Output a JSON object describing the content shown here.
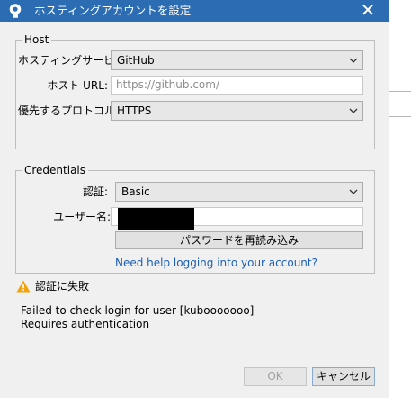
{
  "window": {
    "title": "ホスティングアカウントを設定",
    "close_glyph": "✕"
  },
  "host": {
    "legend": "Host",
    "service_label": "ホスティングサービス:",
    "service_value": "GitHub",
    "url_label": "ホスト URL:",
    "url_placeholder": "https://github.com/",
    "protocol_label": "優先するプロトコル:",
    "protocol_value": "HTTPS"
  },
  "credentials": {
    "legend": "Credentials",
    "auth_label": "認証:",
    "auth_value": "Basic",
    "username_label": "ユーザー名:",
    "username_value": "",
    "reload_password_button": "パスワードを再読み込み",
    "help_link": "Need help logging into your account?"
  },
  "status": {
    "icon": "warning-icon",
    "title": "認証に失敗",
    "message_line1": "Failed to check login for user [kubooooooo]",
    "message_line2": "Requires authentication"
  },
  "buttons": {
    "ok": "OK",
    "cancel": "キャンセル"
  },
  "colors": {
    "titlebar": "#2b6cb2",
    "link": "#1a5fb4",
    "warning": "#f0a30a"
  }
}
